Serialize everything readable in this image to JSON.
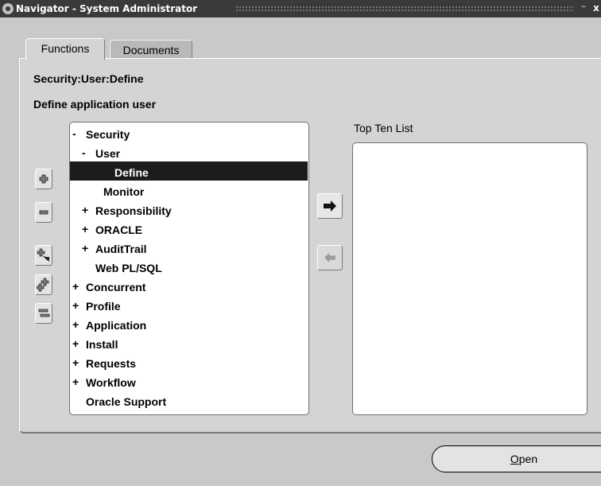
{
  "window": {
    "title": "Navigator - System Administrator",
    "minimize_glyph": "⁻",
    "close_glyph": "x"
  },
  "tabs": [
    {
      "label": "Functions",
      "active": true
    },
    {
      "label": "Documents",
      "active": false
    }
  ],
  "current_function": "Security:User:Define",
  "description": "Define application user",
  "tree": [
    {
      "sign": "-",
      "label": "Security",
      "level": 0
    },
    {
      "sign": "-",
      "label": "User",
      "level": 1
    },
    {
      "sign": "",
      "label": "Define",
      "level": 2,
      "selected": true
    },
    {
      "sign": "",
      "label": "Monitor",
      "level": 2
    },
    {
      "sign": "+",
      "label": "Responsibility",
      "level": 1
    },
    {
      "sign": "+",
      "label": "ORACLE",
      "level": 1
    },
    {
      "sign": "+",
      "label": "AuditTrail",
      "level": 1
    },
    {
      "sign": "",
      "label": "Web PL/SQL",
      "level": 1
    },
    {
      "sign": "+",
      "label": "Concurrent",
      "level": 0
    },
    {
      "sign": "+",
      "label": "Profile",
      "level": 0
    },
    {
      "sign": "+",
      "label": "Application",
      "level": 0
    },
    {
      "sign": "+",
      "label": "Install",
      "level": 0
    },
    {
      "sign": "+",
      "label": "Requests",
      "level": 0
    },
    {
      "sign": "+",
      "label": "Workflow",
      "level": 0
    },
    {
      "sign": "",
      "label": "Oracle Support",
      "level": 0
    }
  ],
  "side_buttons": [
    "expand-icon",
    "collapse-icon",
    "expand-branch-icon",
    "expand-all-icon",
    "collapse-all-icon"
  ],
  "top_ten_label": "Top Ten List",
  "open_button": {
    "underlined": "O",
    "rest": "pen"
  },
  "colors": {
    "selection": "#1c1c1c",
    "background": "#c9c9c9",
    "panel": "#d4d4d4"
  }
}
